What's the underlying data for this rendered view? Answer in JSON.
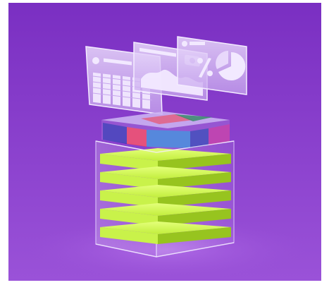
{
  "scene": {
    "background_top": "#7a2fc2",
    "background_bottom": "#9a52d8",
    "panel_glass": "#d9bff5",
    "panel_line": "#f2e9ff",
    "slab_color": "#c9f24a",
    "slab_edge": "#97c41f",
    "top_tile_colors": [
      "#3c2fb7",
      "#e23a6a",
      "#3f78d8",
      "#3a3ab8",
      "#b62ca8",
      "#2f8a63"
    ],
    "icons": [
      "dashboard-panel",
      "area-chart-panel",
      "pie-chart-panel",
      "percent-symbol",
      "database-stack"
    ]
  }
}
